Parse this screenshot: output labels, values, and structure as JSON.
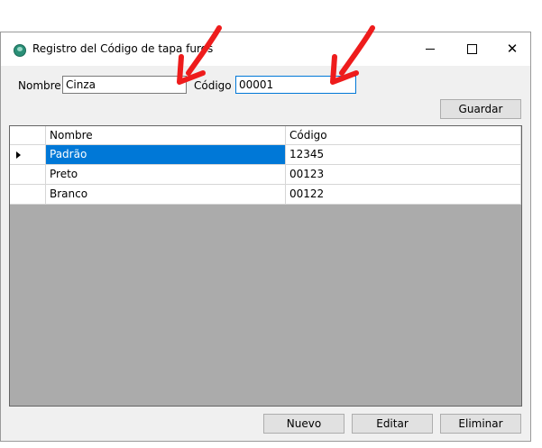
{
  "window": {
    "title": "Registro del Código de tapa furos",
    "controls": {
      "minimize": "minimize",
      "maximize": "maximize",
      "close": "✕"
    }
  },
  "form": {
    "nombre_label": "Nombre",
    "nombre_value": "Cinza",
    "codigo_label": "Código",
    "codigo_value": "00001",
    "guardar_label": "Guardar"
  },
  "grid": {
    "columns": [
      "Nombre",
      "Código"
    ],
    "rows": [
      {
        "nombre": "Padrão",
        "codigo": "12345"
      },
      {
        "nombre": "Preto",
        "codigo": "00123"
      },
      {
        "nombre": "Branco",
        "codigo": "00122"
      }
    ]
  },
  "footer": {
    "nuevo_label": "Nuevo",
    "editar_label": "Editar",
    "eliminar_label": "Eliminar"
  },
  "colors": {
    "annotation_arrow": "#ee1c1c",
    "selection": "#0078d7",
    "grid_background": "#ababab"
  }
}
